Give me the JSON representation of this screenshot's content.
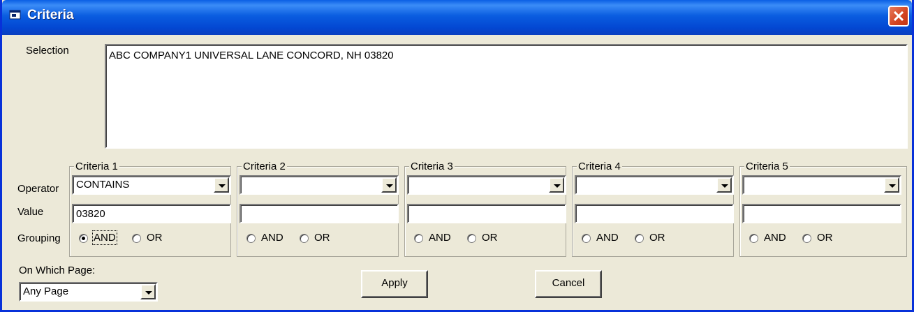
{
  "window": {
    "title": "Criteria"
  },
  "selection": {
    "label": "Selection",
    "value": "ABC COMPANY1 UNIVERSAL LANE CONCORD, NH 03820"
  },
  "row_labels": {
    "operator": "Operator",
    "value": "Value",
    "grouping": "Grouping"
  },
  "criteria": [
    {
      "legend": "Criteria 1",
      "operator": "CONTAINS",
      "value": "03820",
      "and_label": "AND",
      "or_label": "OR",
      "selected": "AND"
    },
    {
      "legend": "Criteria 2",
      "operator": "",
      "value": "",
      "and_label": "AND",
      "or_label": "OR",
      "selected": ""
    },
    {
      "legend": "Criteria 3",
      "operator": "",
      "value": "",
      "and_label": "AND",
      "or_label": "OR",
      "selected": ""
    },
    {
      "legend": "Criteria 4",
      "operator": "",
      "value": "",
      "and_label": "AND",
      "or_label": "OR",
      "selected": ""
    },
    {
      "legend": "Criteria 5",
      "operator": "",
      "value": "",
      "and_label": "AND",
      "or_label": "OR",
      "selected": ""
    }
  ],
  "page": {
    "label": "On Which Page:",
    "value": "Any Page"
  },
  "buttons": {
    "apply": "Apply",
    "cancel": "Cancel"
  },
  "colors": {
    "titlebar": "#0a5de0",
    "face": "#ece9d8",
    "close": "#d24320"
  }
}
